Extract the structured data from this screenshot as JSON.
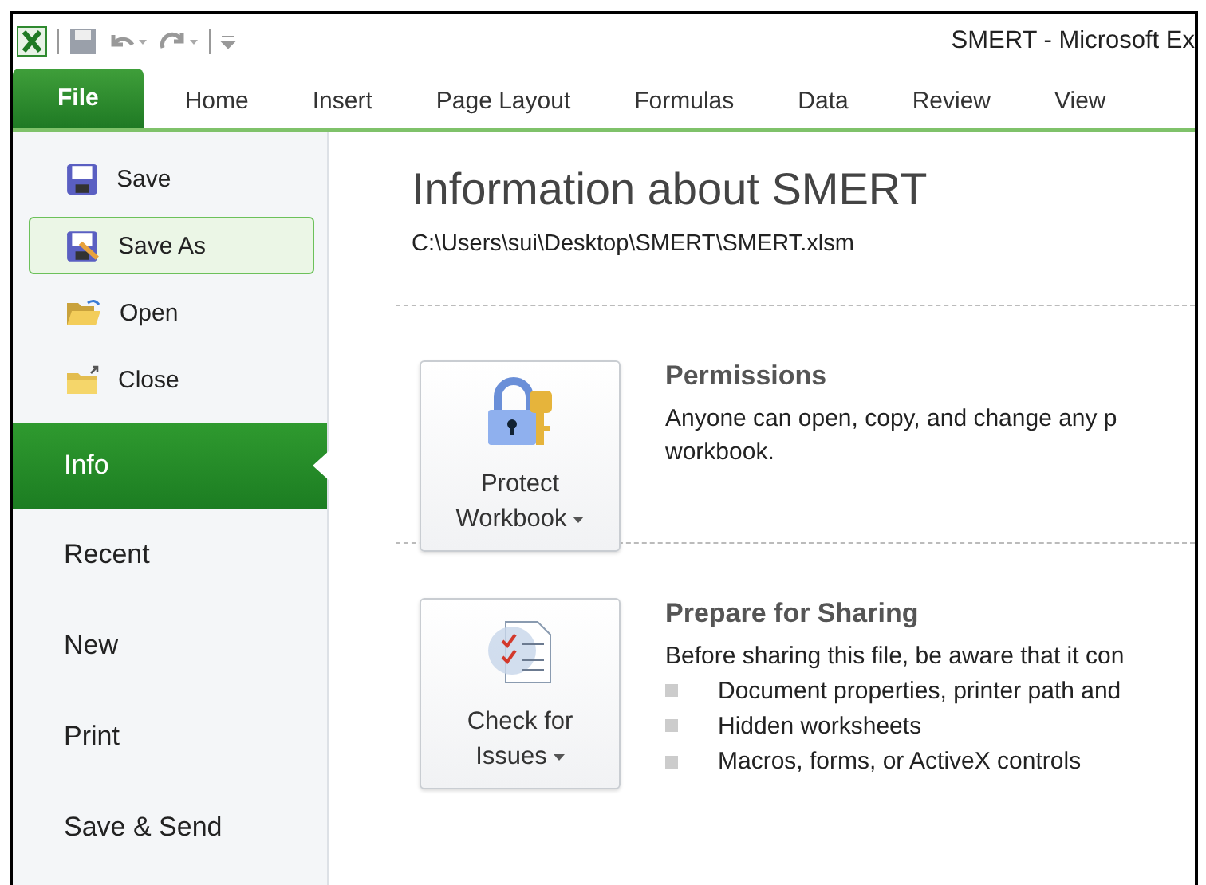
{
  "window": {
    "title": "SMERT - Microsoft Ex"
  },
  "tabs": [
    {
      "label": "File",
      "selected": true
    },
    {
      "label": "Home",
      "selected": false
    },
    {
      "label": "Insert",
      "selected": false
    },
    {
      "label": "Page Layout",
      "selected": false
    },
    {
      "label": "Formulas",
      "selected": false
    },
    {
      "label": "Data",
      "selected": false
    },
    {
      "label": "Review",
      "selected": false
    },
    {
      "label": "View",
      "selected": false
    }
  ],
  "sidebar": {
    "items": [
      {
        "kind": "command",
        "label": "Save",
        "highlighted": false
      },
      {
        "kind": "command",
        "label": "Save As",
        "highlighted": true
      },
      {
        "kind": "command",
        "label": "Open",
        "highlighted": false
      },
      {
        "kind": "command",
        "label": "Close",
        "highlighted": false
      },
      {
        "kind": "section",
        "label": "Info",
        "selected": true
      },
      {
        "kind": "section",
        "label": "Recent",
        "selected": false
      },
      {
        "kind": "section",
        "label": "New",
        "selected": false
      },
      {
        "kind": "section",
        "label": "Print",
        "selected": false
      },
      {
        "kind": "section",
        "label": "Save & Send",
        "selected": false
      }
    ]
  },
  "info": {
    "title": "Information about SMERT",
    "path": "C:\\Users\\sui\\Desktop\\SMERT\\SMERT.xlsm",
    "sections": [
      {
        "button": [
          "Protect",
          "Workbook"
        ],
        "heading": "Permissions",
        "text": "Anyone can open, copy, and change any p",
        "text_2": "workbook."
      },
      {
        "button": [
          "Check for",
          "Issues"
        ],
        "heading": "Prepare for Sharing",
        "text": "Before sharing this file, be aware that it con",
        "bullets": [
          "Document properties, printer path and",
          "Hidden worksheets",
          "Macros, forms, or ActiveX controls"
        ]
      }
    ]
  }
}
